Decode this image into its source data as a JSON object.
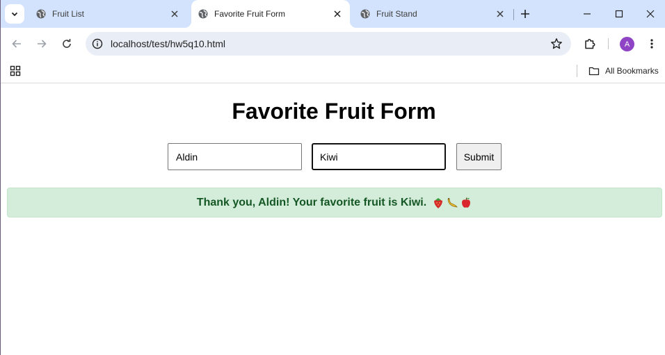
{
  "browser": {
    "tabs": [
      {
        "title": "Fruit List",
        "active": false
      },
      {
        "title": "Favorite Fruit Form",
        "active": true
      },
      {
        "title": "Fruit Stand",
        "active": false
      }
    ],
    "address": "localhost/test/hw5q10.html",
    "profile_initial": "A",
    "bookmarks_label": "All Bookmarks",
    "accent": "#d3e3fd"
  },
  "page": {
    "title": "Favorite Fruit Form",
    "name_value": "Aldin",
    "fruit_value": "Kiwi",
    "submit_label": "Submit",
    "message": "Thank you, Aldin! Your favorite fruit is Kiwi.",
    "message_emoji": [
      "strawberry",
      "banana",
      "apple"
    ],
    "colors": {
      "success_bg": "#d4edda",
      "success_text": "#155724"
    }
  }
}
